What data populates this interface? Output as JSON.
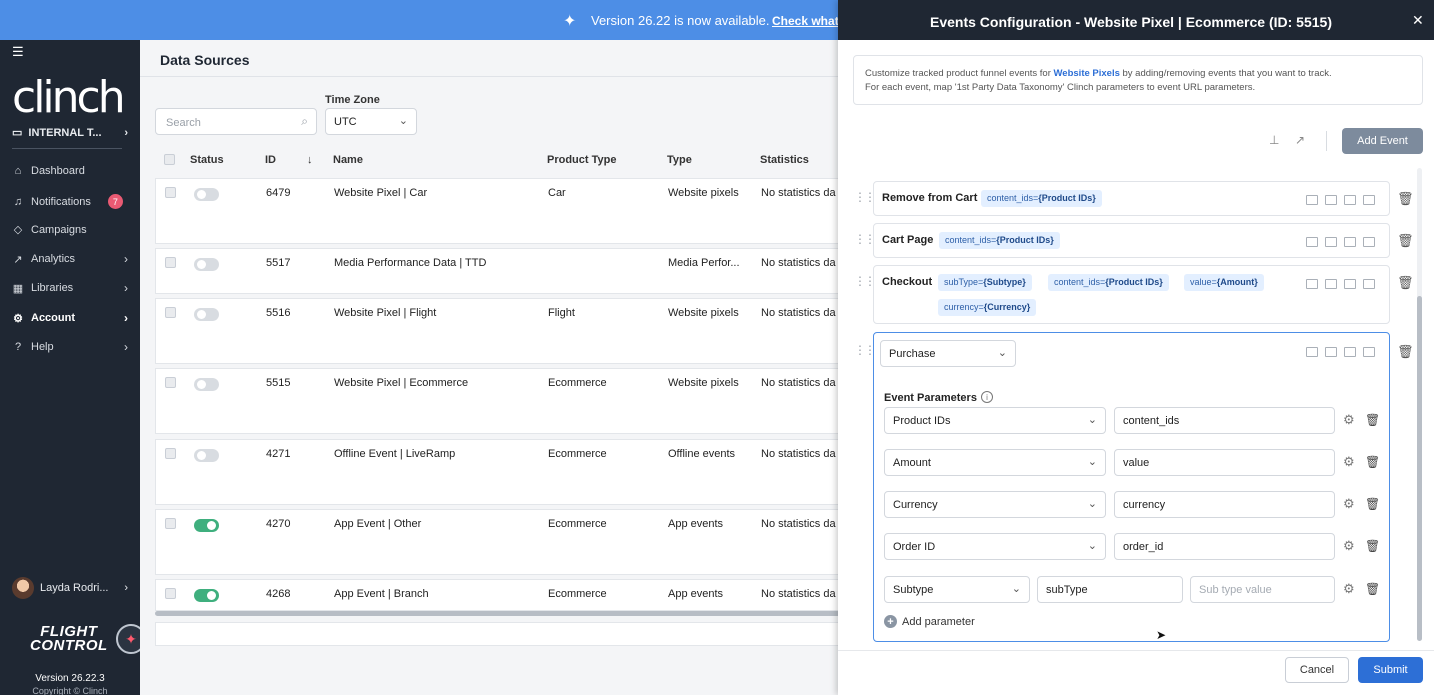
{
  "banner": {
    "message": "Version 26.22 is now available.",
    "link": "Check what's"
  },
  "sidebar": {
    "logo": "clinch",
    "org": "INTERNAL T...",
    "items": [
      {
        "label": "Dashboard",
        "icon": "home-icon"
      },
      {
        "label": "Notifications",
        "icon": "bell-icon",
        "badge": "7"
      },
      {
        "label": "Campaigns",
        "icon": "megaphone-icon"
      },
      {
        "label": "Analytics",
        "icon": "chart-icon"
      },
      {
        "label": "Libraries",
        "icon": "grid-icon"
      },
      {
        "label": "Account",
        "icon": "gear-icon"
      },
      {
        "label": "Help",
        "icon": "help-icon"
      }
    ],
    "user": "Layda Rodri...",
    "brand_line1": "FLIGHT",
    "brand_line2": "CONTROL",
    "version": "Version 26.22.3",
    "copyright": "Copyright © Clinch"
  },
  "main": {
    "title": "Data Sources",
    "search_placeholder": "Search",
    "timezone_label": "Time Zone",
    "timezone_value": "UTC",
    "columns": [
      "Status",
      "ID",
      "Name",
      "Product Type",
      "Type",
      "Statistics"
    ],
    "rows": [
      {
        "enabled": false,
        "id": "6479",
        "name": "Website Pixel | Car",
        "product_type": "Car",
        "type": "Website pixels",
        "stats": "No statistics da"
      },
      {
        "enabled": false,
        "id": "5517",
        "name": "Media Performance Data | TTD",
        "product_type": "",
        "type": "Media Perfor...",
        "stats": "No statistics da"
      },
      {
        "enabled": false,
        "id": "5516",
        "name": "Website Pixel | Flight",
        "product_type": "Flight",
        "type": "Website pixels",
        "stats": "No statistics da"
      },
      {
        "enabled": false,
        "id": "5515",
        "name": "Website Pixel | Ecommerce",
        "product_type": "Ecommerce",
        "type": "Website pixels",
        "stats": "No statistics da"
      },
      {
        "enabled": false,
        "id": "4271",
        "name": "Offline Event | LiveRamp",
        "product_type": "Ecommerce",
        "type": "Offline events",
        "stats": "No statistics da"
      },
      {
        "enabled": true,
        "id": "4270",
        "name": "App Event | Other",
        "product_type": "Ecommerce",
        "type": "App events",
        "stats": "No statistics da"
      },
      {
        "enabled": true,
        "id": "4268",
        "name": "App Event | Branch",
        "product_type": "Ecommerce",
        "type": "App events",
        "stats": "No statistics da"
      }
    ]
  },
  "panel": {
    "title": "Events Configuration - Website Pixel | Ecommerce (ID: 5515)",
    "info_pre": "Customize tracked product funnel events for ",
    "info_link": "Website Pixels",
    "info_post": " by adding/removing events that you want to track.",
    "info_line2": "For each event, map '1st Party Data Taxonomy' Clinch parameters to event URL parameters.",
    "add_event": "Add Event",
    "events": [
      {
        "name": "Remove from Cart",
        "chips": [
          {
            "k": "content_ids=",
            "v": "{Product IDs}"
          }
        ]
      },
      {
        "name": "Cart Page",
        "chips": [
          {
            "k": "content_ids=",
            "v": "{Product IDs}"
          }
        ]
      },
      {
        "name": "Checkout",
        "chips": [
          {
            "k": "subType=",
            "v": "{Subtype}"
          },
          {
            "k": "content_ids=",
            "v": "{Product IDs}"
          },
          {
            "k": "value=",
            "v": "{Amount}"
          },
          {
            "k": "currency=",
            "v": "{Currency}"
          }
        ]
      }
    ],
    "active_event": {
      "selected": "Purchase",
      "params_label": "Event Parameters",
      "params": [
        {
          "field": "Product IDs",
          "value": "content_ids"
        },
        {
          "field": "Amount",
          "value": "value"
        },
        {
          "field": "Currency",
          "value": "currency"
        },
        {
          "field": "Order ID",
          "value": "order_id"
        }
      ],
      "subtype": {
        "field": "Subtype",
        "key": "subType",
        "placeholder": "Sub type value"
      },
      "add_param": "Add parameter"
    },
    "cancel": "Cancel",
    "submit": "Submit"
  }
}
